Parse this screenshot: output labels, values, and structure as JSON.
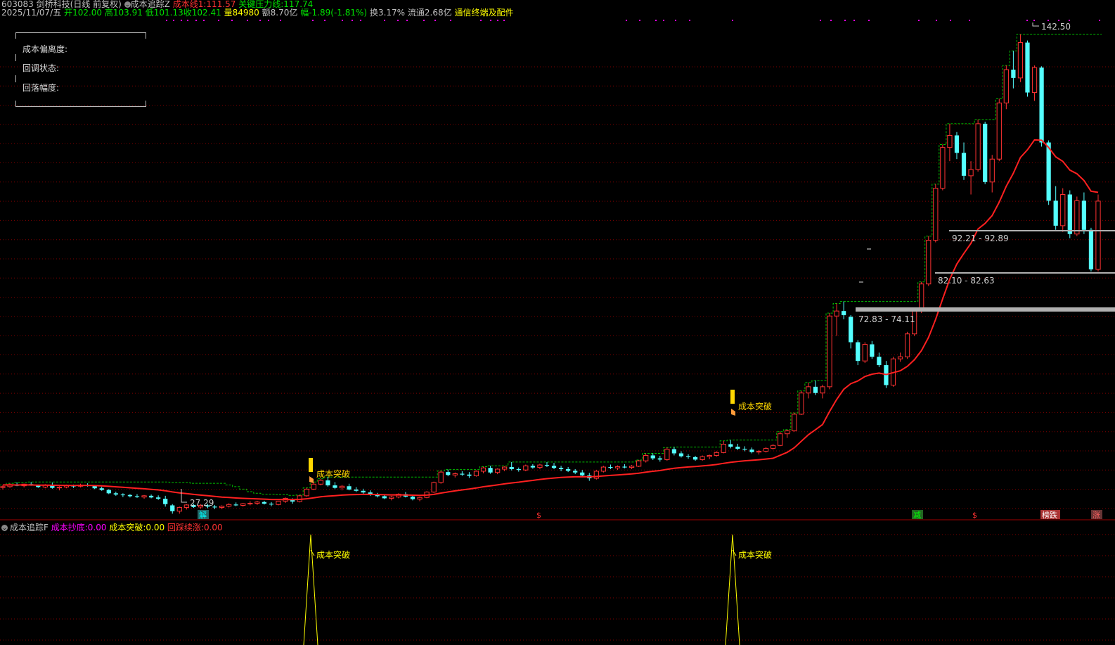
{
  "header": {
    "code": "603083",
    "name": "剑桥科技",
    "mode": "(日线 前复权)",
    "indicator": "成本追踪Z",
    "cost_line_label": "成本线1:",
    "cost_line_value": "111.57",
    "pressure_label": "关键压力线:",
    "pressure_value": "117.74",
    "date": "2025/11/07/五",
    "open_label": "开",
    "open": "102.00",
    "high_label": "高",
    "high": "103.91",
    "low_label": "低",
    "low": "101.13",
    "close_label": "收",
    "close": "102.41",
    "vol_label": "量",
    "vol": "84980",
    "amount_label": "额",
    "amount": "8.70亿",
    "change_label": "幅",
    "change": "-1.89(-1.81%)",
    "turnover_label": "换",
    "turnover": "3.17%",
    "float_label": "流通",
    "float": "2.68亿",
    "sector": "通信终端及配件"
  },
  "info_box": {
    "row1": "成本偏离度:",
    "row2": "回调状态:",
    "row3": "回落幅度:"
  },
  "annotations": {
    "low_price": "27.29",
    "high_price": "142.50",
    "zone1": "92.21 - 92.89",
    "zone2": "82.10 - 82.63",
    "zone3": "72.83 - 74.11",
    "signal": "成本突破"
  },
  "bottom_markers": {
    "m1": "解",
    "m2": "$",
    "m3": "减",
    "m4": "$",
    "m5": "榜跌",
    "m6": "涨"
  },
  "sub_panel": {
    "name": "成本追踪F",
    "bottom_label": "成本抄底:",
    "bottom_value": "0.00",
    "break_label": "成本突破:",
    "break_value": "0.00",
    "pullback_label": "回踩续涨:",
    "pullback_value": "0.00",
    "peak_label": "成本突破"
  },
  "colors": {
    "up": "#ff3232",
    "down": "#54ffff",
    "cost": "#ff2020",
    "pressure": "#00c000",
    "grid": "#800000",
    "signal": "#ffd700",
    "magenta": "#ff00ff"
  },
  "chart_data": {
    "type": "candlestick",
    "y_range": [
      26,
      146
    ],
    "bars": [
      [
        33.6,
        34.2,
        33.1,
        33.8
      ],
      [
        33.8,
        34.6,
        33.5,
        34.3
      ],
      [
        34.3,
        34.8,
        33.9,
        34.0
      ],
      [
        34.0,
        34.5,
        33.6,
        34.4
      ],
      [
        34.4,
        34.9,
        34.0,
        34.1
      ],
      [
        34.1,
        34.3,
        33.5,
        33.7
      ],
      [
        33.7,
        34.4,
        33.4,
        34.2
      ],
      [
        34.2,
        34.8,
        33.3,
        33.5
      ],
      [
        33.5,
        33.9,
        32.9,
        33.7
      ],
      [
        33.7,
        34.3,
        33.4,
        34.0
      ],
      [
        34.0,
        34.3,
        33.5,
        33.9
      ],
      [
        33.9,
        34.5,
        33.6,
        34.2
      ],
      [
        34.2,
        34.6,
        33.8,
        34.1
      ],
      [
        34.1,
        34.2,
        33.2,
        33.4
      ],
      [
        33.4,
        33.8,
        32.8,
        33.0
      ],
      [
        33.0,
        33.2,
        32.0,
        32.2
      ],
      [
        32.2,
        32.6,
        31.6,
        31.9
      ],
      [
        31.9,
        32.2,
        31.3,
        31.8
      ],
      [
        31.8,
        32.0,
        31.2,
        31.5
      ],
      [
        31.5,
        32.0,
        31.1,
        31.3
      ],
      [
        31.3,
        31.8,
        30.9,
        31.6
      ],
      [
        31.6,
        31.9,
        31.0,
        31.2
      ],
      [
        31.2,
        31.7,
        30.6,
        30.9
      ],
      [
        30.9,
        31.6,
        29.0,
        29.6
      ],
      [
        29.3,
        29.6,
        27.3,
        27.9
      ],
      [
        27.9,
        29.0,
        27.3,
        28.8
      ],
      [
        28.8,
        29.6,
        28.3,
        29.4
      ],
      [
        29.4,
        29.7,
        28.7,
        28.9
      ],
      [
        28.9,
        29.6,
        28.5,
        29.3
      ],
      [
        29.3,
        29.7,
        28.6,
        29.0
      ],
      [
        29.0,
        29.4,
        28.4,
        28.8
      ],
      [
        28.8,
        29.3,
        28.4,
        29.1
      ],
      [
        29.1,
        29.8,
        28.8,
        29.5
      ],
      [
        29.5,
        30.0,
        29.1,
        29.3
      ],
      [
        29.3,
        29.9,
        29.0,
        29.7
      ],
      [
        29.7,
        30.3,
        29.3,
        29.8
      ],
      [
        29.8,
        30.4,
        29.4,
        30.1
      ],
      [
        30.1,
        30.4,
        29.5,
        29.7
      ],
      [
        29.7,
        30.1,
        29.1,
        29.5
      ],
      [
        29.5,
        30.4,
        29.3,
        30.3
      ],
      [
        30.3,
        31.2,
        29.9,
        31.0
      ],
      [
        30.8,
        31.0,
        29.7,
        30.2
      ],
      [
        30.2,
        31.8,
        30.0,
        31.6
      ],
      [
        31.6,
        33.5,
        31.4,
        33.2
      ],
      [
        33.2,
        34.9,
        33.0,
        34.4
      ],
      [
        34.4,
        35.7,
        34.1,
        35.3
      ],
      [
        35.3,
        36.1,
        33.8,
        34.1
      ],
      [
        34.1,
        34.9,
        33.2,
        33.5
      ],
      [
        33.5,
        34.2,
        32.9,
        33.9
      ],
      [
        33.9,
        34.5,
        32.9,
        33.1
      ],
      [
        33.1,
        33.7,
        32.5,
        32.8
      ],
      [
        32.8,
        33.3,
        32.1,
        32.4
      ],
      [
        32.4,
        32.9,
        31.6,
        31.8
      ],
      [
        31.8,
        32.3,
        31.2,
        31.5
      ],
      [
        31.5,
        32.0,
        30.8,
        31.0
      ],
      [
        31.0,
        31.6,
        30.5,
        31.3
      ],
      [
        31.3,
        32.2,
        31.0,
        32.0
      ],
      [
        32.0,
        32.5,
        31.2,
        31.4
      ],
      [
        31.4,
        31.8,
        30.5,
        30.8
      ],
      [
        30.8,
        31.4,
        30.3,
        31.2
      ],
      [
        31.2,
        32.7,
        31.0,
        32.5
      ],
      [
        32.5,
        35.0,
        32.3,
        34.8
      ],
      [
        34.8,
        37.6,
        34.5,
        37.3
      ],
      [
        37.3,
        37.9,
        36.3,
        36.6
      ],
      [
        36.6,
        37.2,
        36.0,
        36.9
      ],
      [
        36.9,
        37.5,
        36.4,
        36.7
      ],
      [
        36.7,
        37.3,
        35.9,
        36.4
      ],
      [
        36.4,
        37.7,
        36.2,
        37.5
      ],
      [
        37.5,
        38.6,
        37.0,
        38.3
      ],
      [
        38.3,
        38.8,
        36.9,
        37.2
      ],
      [
        37.2,
        38.2,
        36.8,
        38.0
      ],
      [
        38.0,
        38.7,
        37.5,
        38.5
      ],
      [
        38.5,
        39.7,
        37.7,
        38.0
      ],
      [
        38.0,
        38.4,
        37.4,
        37.8
      ],
      [
        37.8,
        39.1,
        37.5,
        38.8
      ],
      [
        38.8,
        39.2,
        38.1,
        38.4
      ],
      [
        38.4,
        39.3,
        38.0,
        39.0
      ],
      [
        39.0,
        39.7,
        38.5,
        38.8
      ],
      [
        38.8,
        39.5,
        38.0,
        38.3
      ],
      [
        38.3,
        38.8,
        37.5,
        38.0
      ],
      [
        38.0,
        38.5,
        37.3,
        37.6
      ],
      [
        37.6,
        38.0,
        36.8,
        37.2
      ],
      [
        37.2,
        37.8,
        36.2,
        36.5
      ],
      [
        36.5,
        37.1,
        35.2,
        35.8
      ],
      [
        35.8,
        37.8,
        35.5,
        37.5
      ],
      [
        37.5,
        38.8,
        37.2,
        38.5
      ],
      [
        38.5,
        39.1,
        38.0,
        38.3
      ],
      [
        38.3,
        38.9,
        37.8,
        38.6
      ],
      [
        38.6,
        39.2,
        38.2,
        38.4
      ],
      [
        38.4,
        39.0,
        38.0,
        38.7
      ],
      [
        38.7,
        40.2,
        38.5,
        40.0
      ],
      [
        40.0,
        41.8,
        39.6,
        41.3
      ],
      [
        41.3,
        41.8,
        40.2,
        40.6
      ],
      [
        40.6,
        41.2,
        39.8,
        40.3
      ],
      [
        40.3,
        43.2,
        40.0,
        42.8
      ],
      [
        42.8,
        43.3,
        41.3,
        41.8
      ],
      [
        41.8,
        42.3,
        40.8,
        41.1
      ],
      [
        41.1,
        41.6,
        40.5,
        40.9
      ],
      [
        40.9,
        41.2,
        40.0,
        40.3
      ],
      [
        40.3,
        41.3,
        40.0,
        41.0
      ],
      [
        41.0,
        41.5,
        40.4,
        41.3
      ],
      [
        41.3,
        42.3,
        41.0,
        42.0
      ],
      [
        42.0,
        44.8,
        41.8,
        44.0
      ],
      [
        44.0,
        45.0,
        43.0,
        43.4
      ],
      [
        43.4,
        44.1,
        42.6,
        42.9
      ],
      [
        42.9,
        43.5,
        42.3,
        42.7
      ],
      [
        42.7,
        43.2,
        41.8,
        42.1
      ],
      [
        42.1,
        42.6,
        41.5,
        42.3
      ],
      [
        42.3,
        43.3,
        42.0,
        43.0
      ],
      [
        43.0,
        44.0,
        42.7,
        43.7
      ],
      [
        43.7,
        47.0,
        43.5,
        46.5
      ],
      [
        46.5,
        47.5,
        45.5,
        47.2
      ],
      [
        47.2,
        51.5,
        47.0,
        51.2
      ],
      [
        51.2,
        56.8,
        51.0,
        56.3
      ],
      [
        56.3,
        58.8,
        55.0,
        57.8
      ],
      [
        57.8,
        59.3,
        55.8,
        56.3
      ],
      [
        56.3,
        58.3,
        55.0,
        57.8
      ],
      [
        57.8,
        75.5,
        57.2,
        74.8
      ],
      [
        74.8,
        77.8,
        70.0,
        76.0
      ],
      [
        76.0,
        78.3,
        74.0,
        75.0
      ],
      [
        74.6,
        75.0,
        67.0,
        68.5
      ],
      [
        68.5,
        69.0,
        63.0,
        64.0
      ],
      [
        64.0,
        68.5,
        63.5,
        68.0
      ],
      [
        68.0,
        68.8,
        64.5,
        65.0
      ],
      [
        65.0,
        66.0,
        62.5,
        63.0
      ],
      [
        63.0,
        64.0,
        57.5,
        58.2
      ],
      [
        58.2,
        65.0,
        57.8,
        64.5
      ],
      [
        64.5,
        66.0,
        63.8,
        65.0
      ],
      [
        65.0,
        71.0,
        64.5,
        70.5
      ],
      [
        70.5,
        76.8,
        70.0,
        76.0
      ],
      [
        76.0,
        83.0,
        75.5,
        82.5
      ],
      [
        82.5,
        94.0,
        82.0,
        93.0
      ],
      [
        93.0,
        106.5,
        92.5,
        105.5
      ],
      [
        105.5,
        116.0,
        105.0,
        115.3
      ],
      [
        115.3,
        121.0,
        112.0,
        118.2
      ],
      [
        118.2,
        119.0,
        112.5,
        114.0
      ],
      [
        114.0,
        116.5,
        107.5,
        108.5
      ],
      [
        108.5,
        112.0,
        104.0,
        110.0
      ],
      [
        110.0,
        122.0,
        109.5,
        121.0
      ],
      [
        121.0,
        121.5,
        106.5,
        107.0
      ],
      [
        107.0,
        113.5,
        104.5,
        112.5
      ],
      [
        112.5,
        127.0,
        112.0,
        126.0
      ],
      [
        126.0,
        135.0,
        124.5,
        134.0
      ],
      [
        134.0,
        138.5,
        129.5,
        132.0
      ],
      [
        132.0,
        142.5,
        131.0,
        140.5
      ],
      [
        140.5,
        141.0,
        127.5,
        128.5
      ],
      [
        128.5,
        135.0,
        126.5,
        134.5
      ],
      [
        134.5,
        134.8,
        115.5,
        116.5
      ],
      [
        116.5,
        117.0,
        101.5,
        102.5
      ],
      [
        102.5,
        106.0,
        95.5,
        96.5
      ],
      [
        96.5,
        105.5,
        95.0,
        104.0
      ],
      [
        104.0,
        105.0,
        93.5,
        94.5
      ],
      [
        94.5,
        103.5,
        94.0,
        102.5
      ],
      [
        102.5,
        104.5,
        94.5,
        95.5
      ],
      [
        95.5,
        96.0,
        85.5,
        86.0
      ],
      [
        86.0,
        104.0,
        85.5,
        102.41
      ]
    ]
  }
}
